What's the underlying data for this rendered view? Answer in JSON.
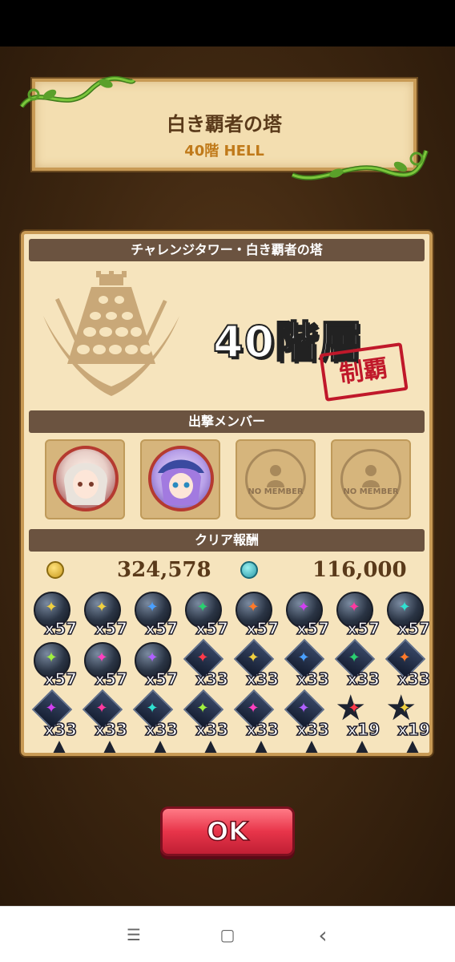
{
  "header": {
    "title": "白き覇者の塔",
    "subtitle": "40階 HELL"
  },
  "panel": {
    "tower_heading": "チャレンジタワー・白き覇者の塔",
    "floor_label": "40階層",
    "stamp_label": "制覇",
    "members_heading": "出撃メンバー",
    "no_member_label": "NO MEMBER",
    "rewards_heading": "クリア報酬",
    "gold_amount": "324,578",
    "exp_amount": "116,000"
  },
  "items": [
    {
      "qty": "x57",
      "shape": "orb",
      "color": "#f0d040"
    },
    {
      "qty": "x57",
      "shape": "orb",
      "color": "#f0d040"
    },
    {
      "qty": "x57",
      "shape": "orb",
      "color": "#4aa0ff"
    },
    {
      "qty": "x57",
      "shape": "orb",
      "color": "#2ad070"
    },
    {
      "qty": "x57",
      "shape": "orb",
      "color": "#ff7a2a"
    },
    {
      "qty": "x57",
      "shape": "orb",
      "color": "#d040f0"
    },
    {
      "qty": "x57",
      "shape": "orb",
      "color": "#ff3aa0"
    },
    {
      "qty": "x57",
      "shape": "orb",
      "color": "#30e0d0"
    },
    {
      "qty": "x57",
      "shape": "orb",
      "color": "#a0f040"
    },
    {
      "qty": "x57",
      "shape": "orb",
      "color": "#ff40c0"
    },
    {
      "qty": "x57",
      "shape": "orb",
      "color": "#b060ff"
    },
    {
      "qty": "x33",
      "shape": "gem",
      "color": "#ff3a4a"
    },
    {
      "qty": "x33",
      "shape": "gem",
      "color": "#f0d040"
    },
    {
      "qty": "x33",
      "shape": "gem",
      "color": "#4aa0ff"
    },
    {
      "qty": "x33",
      "shape": "gem",
      "color": "#2ad070"
    },
    {
      "qty": "x33",
      "shape": "gem",
      "color": "#ff7a2a"
    },
    {
      "qty": "x33",
      "shape": "gem",
      "color": "#d040f0"
    },
    {
      "qty": "x33",
      "shape": "gem",
      "color": "#ff3aa0"
    },
    {
      "qty": "x33",
      "shape": "gem",
      "color": "#30e0d0"
    },
    {
      "qty": "x33",
      "shape": "gem",
      "color": "#a0f040"
    },
    {
      "qty": "x33",
      "shape": "gem",
      "color": "#ff40c0"
    },
    {
      "qty": "x33",
      "shape": "gem",
      "color": "#b060ff"
    },
    {
      "qty": "x19",
      "shape": "star",
      "color": "#ff3a4a"
    },
    {
      "qty": "x19",
      "shape": "star",
      "color": "#f0d040"
    }
  ],
  "ok_button": "OK",
  "nav": {
    "menu_glyph": "☰",
    "home_glyph": "▢",
    "back_glyph": "‹"
  }
}
